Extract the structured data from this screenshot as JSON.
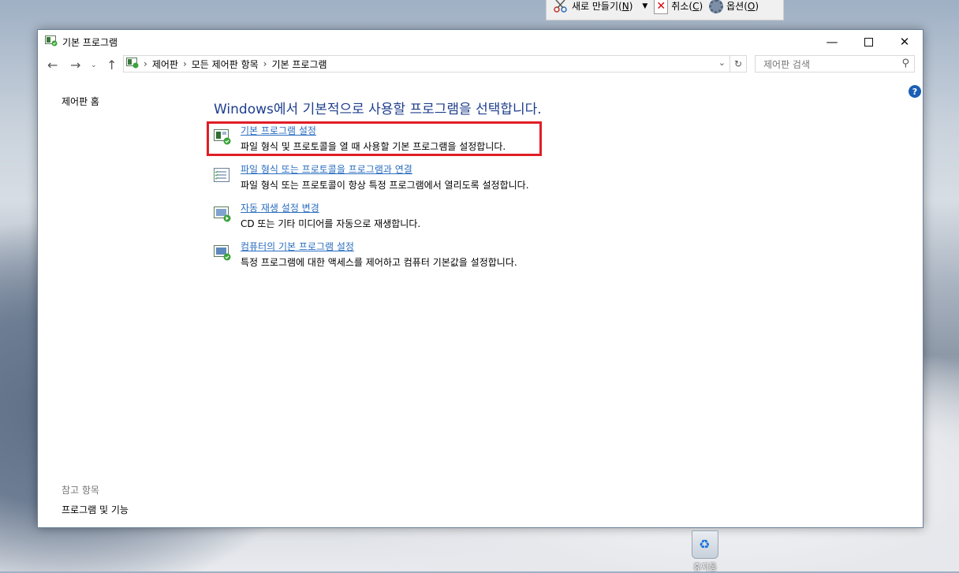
{
  "snip": {
    "new_label": "새로 만들기(",
    "new_key": "N",
    "new_tail": ")",
    "cancel_label": "취소(",
    "cancel_key": "C",
    "cancel_tail": ")",
    "options_label": "옵션(",
    "options_key": "O",
    "options_tail": ")"
  },
  "window": {
    "title": "기본 프로그램"
  },
  "address": {
    "crumbs": [
      "제어판",
      "모든 제어판 항목",
      "기본 프로그램"
    ]
  },
  "search": {
    "placeholder": "제어판 검색"
  },
  "sidebar": {
    "home": "제어판 홈",
    "see_also_heading": "참고 항목",
    "see_also_link": "프로그램 및 기능"
  },
  "main": {
    "heading": "Windows에서 기본적으로 사용할 프로그램을 선택합니다.",
    "tasks": [
      {
        "link": "기본 프로그램 설정",
        "desc": "파일 형식 및 프로토콜을 열 때 사용할 기본 프로그램을 설정합니다."
      },
      {
        "link": "파일 형식 또는 프로토콜을 프로그램과 연결",
        "desc": "파일 형식 또는 프로토콜이 항상 특정 프로그램에서 열리도록 설정합니다."
      },
      {
        "link": "자동 재생 설정 변경",
        "desc": "CD 또는 기타 미디어를 자동으로 재생합니다."
      },
      {
        "link": "컴퓨터의 기본 프로그램 설정",
        "desc": "특정 프로그램에 대한 액세스를 제어하고 컴퓨터 기본값을 설정합니다."
      }
    ]
  },
  "desktop": {
    "recycle_label": "휴지통"
  },
  "colors": {
    "highlight": "#e01e25",
    "link": "#2a6ebf",
    "heading": "#1e3e8c"
  }
}
